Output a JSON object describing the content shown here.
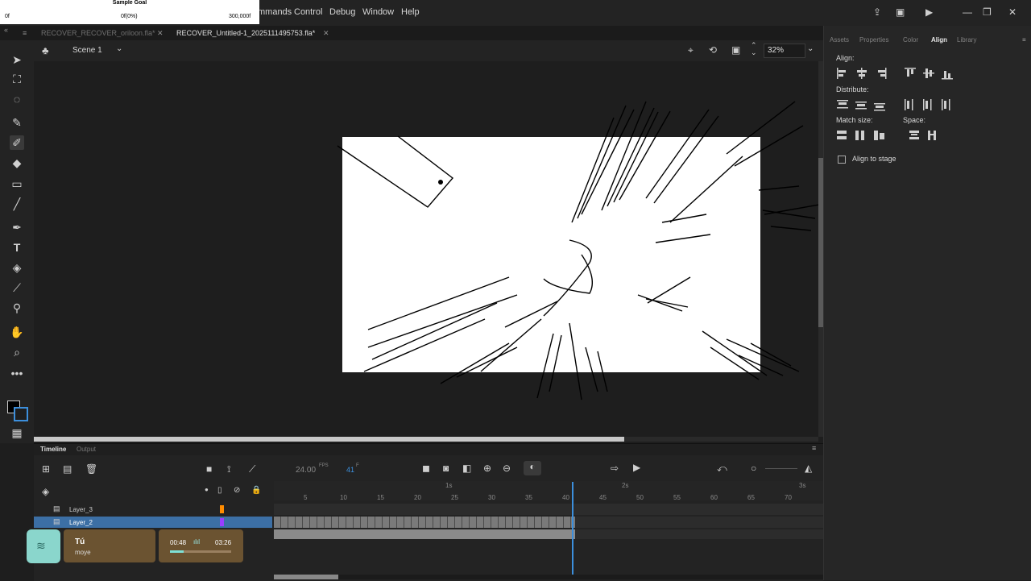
{
  "goal": {
    "title": "Sample Goal",
    "left": "0f",
    "mid": "0f(0%)",
    "right": "300,000f"
  },
  "menu": [
    "mmands",
    "Control",
    "Debug",
    "Window",
    "Help"
  ],
  "tabs": [
    "RECOVER_RECOVER_oriloon.fla*",
    "RECOVER_Untitled-1_2025111495753.fla*"
  ],
  "scene": {
    "name": "Scene 1",
    "zoom": "32%"
  },
  "panel": {
    "tabs": [
      "Assets",
      "Properties",
      "Color",
      "Align",
      "Library"
    ],
    "active": "Align",
    "align_label": "Align:",
    "distribute_label": "Distribute:",
    "match_label": "Match size:",
    "space_label": "Space:",
    "align_stage": "Align to stage"
  },
  "timeline": {
    "tab_timeline": "Timeline",
    "tab_output": "Output",
    "fps": "24.00",
    "fps_unit": "FPS",
    "frame": "41",
    "frame_unit": "F",
    "sec_marks": [
      "1s",
      "2s",
      "3s"
    ],
    "frame_marks": [
      "5",
      "10",
      "15",
      "20",
      "25",
      "30",
      "35",
      "40",
      "45",
      "50",
      "55",
      "60",
      "65",
      "70"
    ],
    "layers": [
      "Layer_3",
      "Layer_2"
    ]
  },
  "overlay": {
    "user": "Tú",
    "sub": "moye",
    "time_cur": "00:48",
    "time_total": "03:26",
    "progress": 0.23
  }
}
